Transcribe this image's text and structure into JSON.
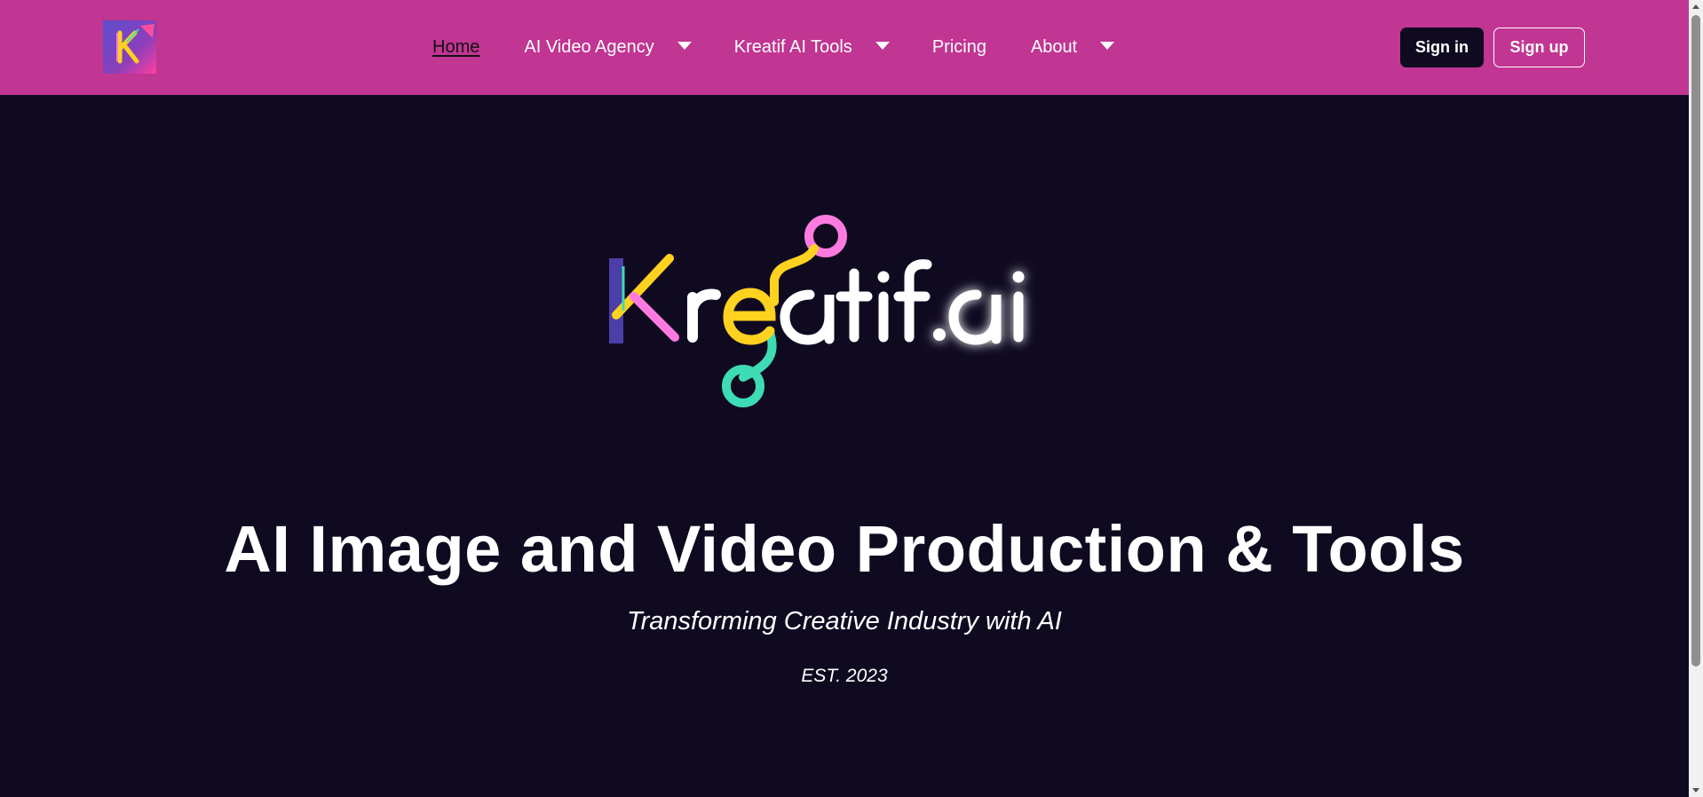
{
  "nav": {
    "logo_icon": "kreatif-k-logo",
    "links": [
      {
        "label": "Home",
        "active": true,
        "dropdown": false
      },
      {
        "label": "AI Video Agency",
        "dropdown": true
      },
      {
        "label": "Kreatif AI Tools",
        "dropdown": true
      },
      {
        "label": "Pricing",
        "dropdown": false
      },
      {
        "label": "About",
        "dropdown": true
      }
    ],
    "signin_label": "Sign in",
    "signup_label": "Sign up"
  },
  "hero": {
    "logo_text": "Kreatif.ai",
    "title": "AI Image and Video Production & Tools",
    "subtitle": "Transforming Creative Industry with AI",
    "established": "EST. 2023"
  },
  "colors": {
    "nav_bg": "#c13593",
    "page_bg": "#100a21",
    "signin_bg": "#100a21",
    "logo_pink": "#ff7ae0",
    "logo_yellow": "#ffd21f",
    "logo_teal": "#3ddcb4",
    "text": "#ffffff"
  }
}
